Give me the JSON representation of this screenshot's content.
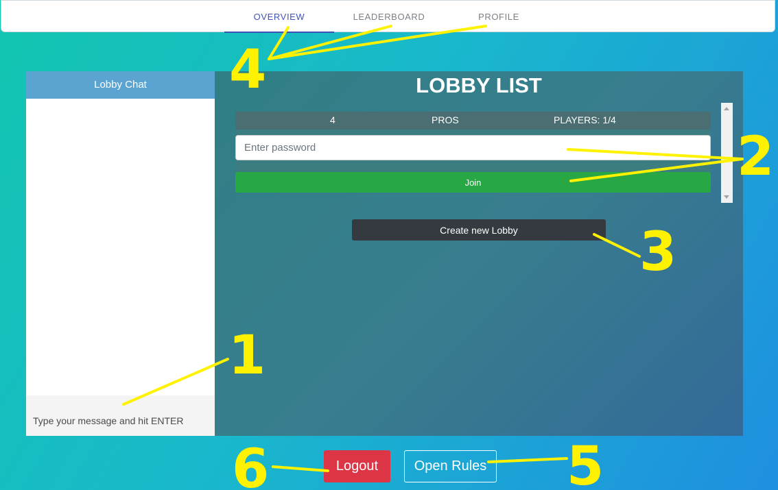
{
  "nav": {
    "tabs": [
      {
        "label": "OVERVIEW",
        "active": true
      },
      {
        "label": "LEADERBOARD",
        "active": false
      },
      {
        "label": "PROFILE",
        "active": false
      }
    ],
    "accent": "#3f51b5"
  },
  "chat": {
    "header": "Lobby Chat",
    "input_placeholder": "Type your message and hit ENTER"
  },
  "lobby": {
    "title": "LOBBY LIST",
    "entries": [
      {
        "id": "4",
        "name": "PROS",
        "players": "PLAYERS: 1/4",
        "password_placeholder": "Enter password",
        "join_label": "Join"
      }
    ],
    "create_label": "Create new Lobby"
  },
  "footer": {
    "logout_label": "Logout",
    "rules_label": "Open Rules"
  },
  "annotations": [
    "1",
    "2",
    "3",
    "4",
    "5",
    "6"
  ],
  "colors": {
    "join": "#28a745",
    "logout": "#dc3545",
    "create": "#343a40",
    "chat_header": "#5ba3d0",
    "annotation": "#fff200"
  }
}
